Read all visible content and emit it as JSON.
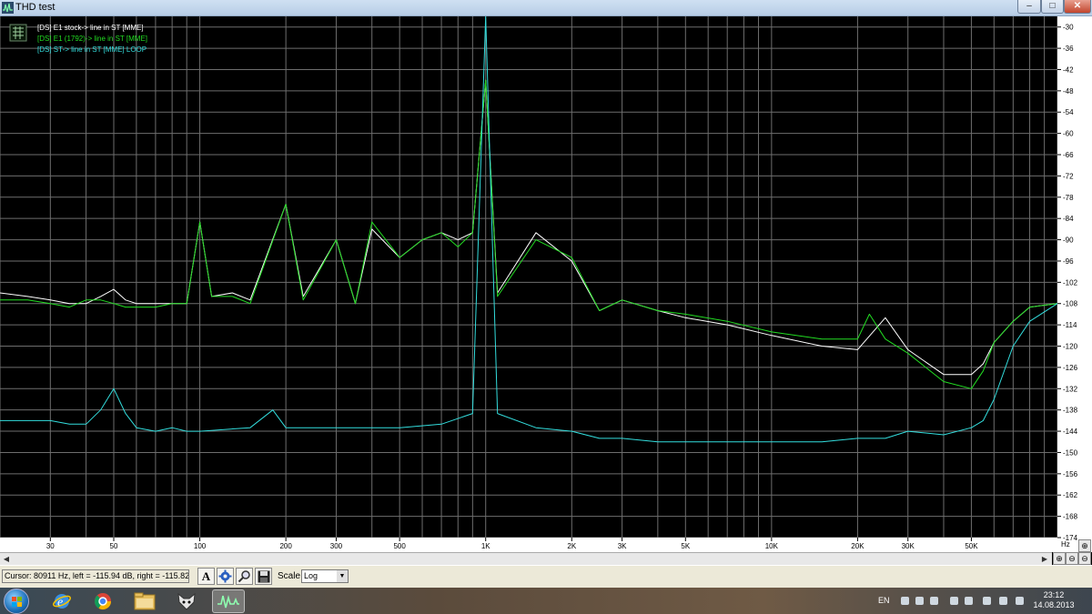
{
  "window": {
    "title": "THD test",
    "min_glyph": "–",
    "max_glyph": "□",
    "close_glyph": "✕"
  },
  "plot": {
    "legend": [
      {
        "label": "[DS] E1 stock-> line in ST [MME]",
        "color": "#ffffff"
      },
      {
        "label": "[DS] E1 (1792)-> line in ST [MME]",
        "color": "#22dd22"
      },
      {
        "label": "[DS] ST-> line in ST [MME] LOOP",
        "color": "#33dddd"
      }
    ],
    "x_ticks": [
      "30",
      "50",
      "100",
      "200",
      "300",
      "500",
      "1K",
      "2K",
      "3K",
      "5K",
      "10K",
      "20K",
      "30K",
      "50K",
      "Hz"
    ],
    "y_ticks": [
      "-30",
      "-36",
      "-42",
      "-48",
      "-54",
      "-60",
      "-66",
      "-72",
      "-78",
      "-84",
      "-90",
      "-96",
      "-102",
      "-108",
      "-114",
      "-120",
      "-126",
      "-132",
      "-138",
      "-144",
      "-150",
      "-156",
      "-162",
      "-168",
      "-174"
    ],
    "colors": {
      "background": "#000000",
      "grid": "#6e6e6e",
      "axis_text": "#000000",
      "axis_bg": "#ffffff"
    }
  },
  "chart_data": {
    "type": "line",
    "xscale": "log",
    "xlim": [
      20,
      100000
    ],
    "ylim": [
      -174,
      -27
    ],
    "xlabel": "Hz",
    "ylabel": "",
    "grid": true,
    "legend_position": "top-left",
    "series": [
      {
        "name": "[DS] E1 stock-> line in ST [MME]",
        "color": "#ffffff",
        "points": [
          [
            20,
            -105
          ],
          [
            25,
            -106
          ],
          [
            30,
            -107
          ],
          [
            35,
            -108
          ],
          [
            40,
            -108
          ],
          [
            45,
            -106
          ],
          [
            50,
            -104
          ],
          [
            55,
            -107
          ],
          [
            60,
            -108
          ],
          [
            70,
            -108
          ],
          [
            80,
            -108
          ],
          [
            90,
            -108
          ],
          [
            100,
            -85
          ],
          [
            110,
            -106
          ],
          [
            130,
            -105
          ],
          [
            150,
            -107
          ],
          [
            200,
            -80
          ],
          [
            230,
            -106
          ],
          [
            300,
            -90
          ],
          [
            350,
            -108
          ],
          [
            400,
            -87
          ],
          [
            500,
            -95
          ],
          [
            600,
            -90
          ],
          [
            700,
            -88
          ],
          [
            800,
            -90
          ],
          [
            900,
            -88
          ],
          [
            1000,
            -45
          ],
          [
            1100,
            -105
          ],
          [
            1500,
            -88
          ],
          [
            2000,
            -96
          ],
          [
            2500,
            -110
          ],
          [
            3000,
            -107
          ],
          [
            4000,
            -110
          ],
          [
            5000,
            -112
          ],
          [
            7000,
            -114
          ],
          [
            10000,
            -117
          ],
          [
            15000,
            -120
          ],
          [
            20000,
            -121
          ],
          [
            25000,
            -112
          ],
          [
            30000,
            -121
          ],
          [
            40000,
            -128
          ],
          [
            50000,
            -128
          ],
          [
            55000,
            -125
          ],
          [
            60000,
            -119
          ],
          [
            70000,
            -113
          ],
          [
            80000,
            -109
          ],
          [
            100000,
            -108
          ]
        ]
      },
      {
        "name": "[DS] E1 (1792)-> line in ST [MME]",
        "color": "#22dd22",
        "points": [
          [
            20,
            -107
          ],
          [
            25,
            -107
          ],
          [
            30,
            -108
          ],
          [
            35,
            -109
          ],
          [
            40,
            -107
          ],
          [
            45,
            -107
          ],
          [
            50,
            -108
          ],
          [
            55,
            -109
          ],
          [
            60,
            -109
          ],
          [
            70,
            -109
          ],
          [
            80,
            -108
          ],
          [
            90,
            -108
          ],
          [
            100,
            -85
          ],
          [
            110,
            -106
          ],
          [
            130,
            -106
          ],
          [
            150,
            -108
          ],
          [
            200,
            -80
          ],
          [
            230,
            -107
          ],
          [
            300,
            -90
          ],
          [
            350,
            -108
          ],
          [
            400,
            -85
          ],
          [
            500,
            -95
          ],
          [
            600,
            -90
          ],
          [
            700,
            -88
          ],
          [
            800,
            -92
          ],
          [
            900,
            -88
          ],
          [
            1000,
            -45
          ],
          [
            1100,
            -106
          ],
          [
            1500,
            -90
          ],
          [
            2000,
            -95
          ],
          [
            2500,
            -110
          ],
          [
            3000,
            -107
          ],
          [
            4000,
            -110
          ],
          [
            5000,
            -111
          ],
          [
            7000,
            -113
          ],
          [
            10000,
            -116
          ],
          [
            15000,
            -118
          ],
          [
            20000,
            -118
          ],
          [
            22000,
            -111
          ],
          [
            25000,
            -118
          ],
          [
            30000,
            -122
          ],
          [
            40000,
            -130
          ],
          [
            50000,
            -132
          ],
          [
            55000,
            -127
          ],
          [
            60000,
            -119
          ],
          [
            70000,
            -113
          ],
          [
            80000,
            -109
          ],
          [
            100000,
            -108
          ]
        ]
      },
      {
        "name": "[DS] ST-> line in ST [MME] LOOP",
        "color": "#33dddd",
        "points": [
          [
            20,
            -141
          ],
          [
            25,
            -141
          ],
          [
            30,
            -141
          ],
          [
            35,
            -142
          ],
          [
            40,
            -142
          ],
          [
            45,
            -138
          ],
          [
            50,
            -132
          ],
          [
            55,
            -139
          ],
          [
            60,
            -143
          ],
          [
            70,
            -144
          ],
          [
            80,
            -143
          ],
          [
            90,
            -144
          ],
          [
            100,
            -144
          ],
          [
            150,
            -143
          ],
          [
            180,
            -138
          ],
          [
            200,
            -143
          ],
          [
            300,
            -143
          ],
          [
            500,
            -143
          ],
          [
            700,
            -142
          ],
          [
            900,
            -139
          ],
          [
            1000,
            -27
          ],
          [
            1100,
            -139
          ],
          [
            1500,
            -143
          ],
          [
            2000,
            -144
          ],
          [
            2500,
            -146
          ],
          [
            3000,
            -146
          ],
          [
            4000,
            -147
          ],
          [
            5000,
            -147
          ],
          [
            7000,
            -147
          ],
          [
            10000,
            -147
          ],
          [
            15000,
            -147
          ],
          [
            20000,
            -146
          ],
          [
            25000,
            -146
          ],
          [
            30000,
            -144
          ],
          [
            40000,
            -145
          ],
          [
            50000,
            -143
          ],
          [
            55000,
            -141
          ],
          [
            60000,
            -135
          ],
          [
            70000,
            -120
          ],
          [
            80000,
            -113
          ],
          [
            100000,
            -108
          ]
        ]
      }
    ]
  },
  "scrollbar": {
    "left_arrow": "◀",
    "right_arrow": "▶",
    "zoom_in": "⊕",
    "zoom_out": "⊖"
  },
  "status": {
    "cursor": "Cursor:  80911 Hz,  left = -115.94 dB,  right = -115.82 dB",
    "scale_label": "Scale",
    "scale_value": "Log",
    "scale_arrow": "▼",
    "tool_a": "A"
  },
  "taskbar": {
    "lang": "EN",
    "time": "23:12",
    "date": "14.08.2013"
  }
}
